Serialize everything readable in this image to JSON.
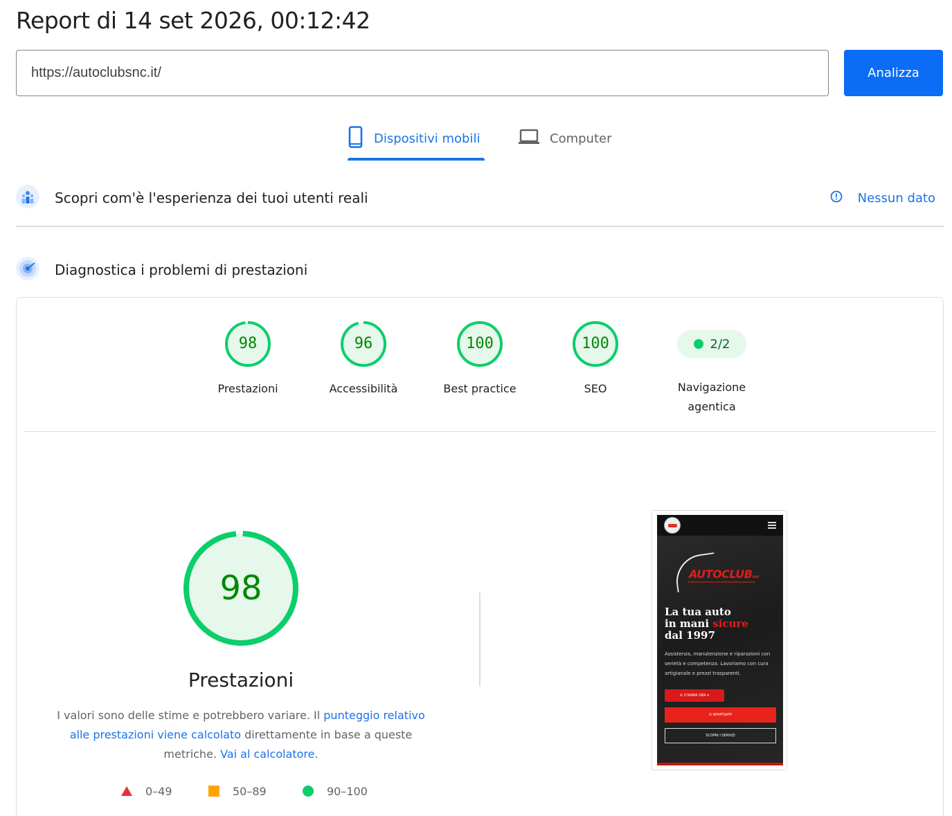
{
  "header": {
    "title": "Report di 14 set 2026, 00:12:42"
  },
  "search": {
    "value": "https://autoclubsnc.it/",
    "button_label": "Analizza"
  },
  "tabs": [
    {
      "label": "Dispositivi mobili",
      "icon": "phone-icon",
      "active": true
    },
    {
      "label": "Computer",
      "icon": "laptop-icon",
      "active": false
    }
  ],
  "field_data": {
    "title": "Scopri com'è l'esperienza dei tuoi utenti reali",
    "status": "Nessun dato"
  },
  "lab_data": {
    "title": "Diagnostica i problemi di prestazioni"
  },
  "categories": [
    {
      "score": "98",
      "label": "Prestazioni"
    },
    {
      "score": "96",
      "label": "Accessibilità"
    },
    {
      "score": "100",
      "label": "Best practice"
    },
    {
      "score": "100",
      "label": "SEO"
    }
  ],
  "agentic": {
    "value": "2/2",
    "label_line1": "Navigazione",
    "label_line2": "agentica"
  },
  "performance": {
    "score": "98",
    "title": "Prestazioni",
    "desc_1": "I valori sono delle stime e potrebbero variare. Il ",
    "link_1": "punteggio relativo alle prestazioni viene calcolato",
    "desc_2": " direttamente in base a queste metriche. ",
    "link_2": "Vai al calcolatore",
    "desc_3": "."
  },
  "legend": [
    {
      "label": "0–49",
      "shape": "triangle",
      "color": "#eb3131"
    },
    {
      "label": "50–89",
      "shape": "square",
      "color": "#ffa400"
    },
    {
      "label": "90–100",
      "shape": "circle",
      "color": "#0cce6b"
    }
  ],
  "screenshot": {
    "brand": "AUTOCLUB",
    "brand_suffix": "snc",
    "headline_1": "La tua auto",
    "headline_2a": "in mani ",
    "headline_2b": "sicure",
    "headline_3": "dal 1997",
    "paragraph": "Assistenza, manutenzione e riparazioni con serietà e competenza. Lavoriamo con cura artigianale e prezzi trasparenti.",
    "btn_call": "✆ CHIAMA ORA ▾",
    "btn_whatsapp": "✆ WHATSAPP",
    "btn_services": "SCOPRI I SERVIZI"
  },
  "colors": {
    "accent": "#1a73e8",
    "button": "#0b6cf5",
    "pass": "#0cce6b",
    "pass_text": "#008800"
  }
}
